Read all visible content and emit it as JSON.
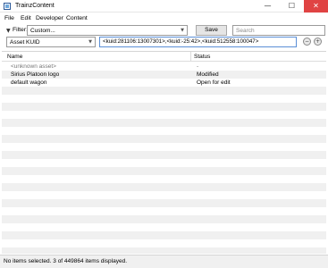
{
  "window": {
    "title": "TrainzContent",
    "icon": "app-icon",
    "controls": {
      "minimize": "—",
      "maximize": "☐",
      "close": "✕"
    }
  },
  "menu": {
    "items": [
      "File",
      "Edit",
      "Developer",
      "Content"
    ]
  },
  "filter": {
    "label": "Filter:",
    "selected": "Custom...",
    "save_label": "Save",
    "search_placeholder": "Search"
  },
  "query": {
    "field_selected": "Asset KUID",
    "value": "<kuid:281106:13007301>,<kuid:-25:42>,<kuid:512558:100047>"
  },
  "list": {
    "columns": [
      "Name",
      "Status"
    ],
    "rows": [
      {
        "name": "<unknown asset>",
        "status": "-"
      },
      {
        "name": "Sirius Platoon logo",
        "status": "Modified"
      },
      {
        "name": "default wagon",
        "status": "Open for edit"
      }
    ]
  },
  "status_bar": {
    "text": "No items selected. 3 of 449864 items displayed."
  },
  "colors": {
    "close_button": "#e04343",
    "focused_border": "#5b8fd6",
    "row_stripe": "#f0f0f0"
  }
}
